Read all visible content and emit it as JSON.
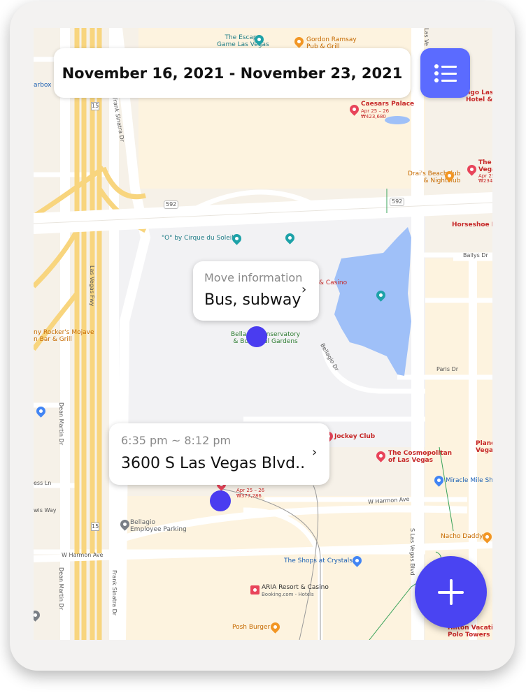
{
  "header": {
    "date_range": "November 16, 2021 - November 23, 2021"
  },
  "buttons": {
    "list_icon": "list-icon",
    "add_icon": "plus-icon"
  },
  "move_card": {
    "title": "Move information",
    "value": "Bus, subway"
  },
  "stop_card": {
    "time": "6:35 pm ~ 8:12 pm",
    "address": "3600 S Las Vegas Blvd.."
  },
  "colors": {
    "accent": "#5b6bff",
    "fab": "#4a44f2",
    "marker": "#4a3cf0",
    "water": "#9fc0f8",
    "highway": "#f8d57e"
  },
  "map_labels": {
    "escape_game": "The Escape\nGame Las Vegas",
    "gordon_ramsay": "Gordon Ramsay\nPub & Grill",
    "arbox": "arbox",
    "frank_sinatra_1": "Frank Sinatra Dr",
    "frank_sinatra_2": "Frank Sinatra Dr",
    "caesars": "Caesars Palace",
    "caesars_dates": "Apr 25 – 26",
    "caesars_price": "₩423,680",
    "highway_15a": "15",
    "highway_15b": "15",
    "drais": "Drai's Beachclub\n& Nightclub",
    "the_c": "The C\nVega",
    "the_c_dates": "Apr 25 – 2",
    "the_c_price": "₩234,",
    "route_592a": "592",
    "route_592b": "592",
    "horseshoe": "Horseshoe La",
    "cirque": "\"O\" by Cirque du Soleil",
    "ballys": "Ballys Dr",
    "las_vegas_fwy": "Las Vegas Fwy",
    "bellagio_casino": "& Casino",
    "bellagio_gardens": "Bellagio Conservatory\n& Botanical Gardens",
    "bellagio_dr": "Bellagio Dr",
    "paris": "Paris Dr",
    "rockers": "ny Rocker's Mojave\nn Bar & Grill",
    "dean_martin_1": "Dean Martin Dr",
    "dean_martin_2": "Dean Martin Dr",
    "jockey": "Jockey Club",
    "cosmopolitan": "The Cosmopolitan\nof Las Vegas",
    "planet": "Plane\nVegas",
    "ess_ln": "ess Ln",
    "miracle": "Miracle Mile Sh",
    "pin_dates": "Apr 25 – 26",
    "pin_price": "₩377,286",
    "w_harmon_1": "W Harmon Ave",
    "wis_way": "wis Way",
    "s_lv_blvd": "S Las Vegas Blvd",
    "bellagio_parking": "Bellagio\nEmployee Parking",
    "nacho": "Nacho Daddy",
    "w_harmon_2": "W Harmon Ave",
    "shops": "The Shops at Crystals",
    "aria": "ARIA Resort & Casino",
    "aria_sub": "Booking.com - Hotels",
    "posh": "Posh Burger",
    "hilton": "Hilton Vacation\nPolo Towers Las V",
    "las_ve": "Las Ve",
    "ngo": "ngo Las\nHotel & C"
  }
}
